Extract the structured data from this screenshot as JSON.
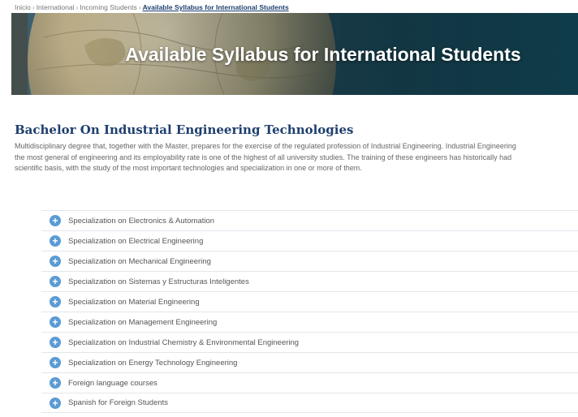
{
  "breadcrumb": {
    "items": [
      "Inicio",
      "International",
      "Incoming Students"
    ],
    "current": "Available Syllabus for International Students"
  },
  "banner": {
    "title": "Available Syllabus for International Students"
  },
  "section": {
    "title": "Bachelor On Industrial Engineering Technologies",
    "intro_lines": [
      "Multidisciplinary degree that, together with the Master, prepares for the exercise of the regulated profession of Industrial Engineering. Industrial Engineering",
      "the most general of engineering and its employability rate is one of the highest of all university studies. The training of these engineers has historically had",
      "scientific basis, with the study of the most important technologies and specialization in one or more of them."
    ]
  },
  "accordion": {
    "icon": "plus-circle-icon",
    "icon_color": "#5b9bd5",
    "items": [
      "Specialization on Electronics & Automation",
      "Specialization on Electrical Engineering",
      "Specialization on Mechanical Engineering",
      "Specialization on Sistemas y Estructuras Inteligentes",
      "Specialization on Material Engineering",
      "Specialization on Management Engineering",
      "Specialization on Industrial Chemistry & Environmental Engineering",
      "Specialization on Energy Technology Engineering",
      "Foreign language courses",
      "Spanish for Foreign Students"
    ]
  }
}
